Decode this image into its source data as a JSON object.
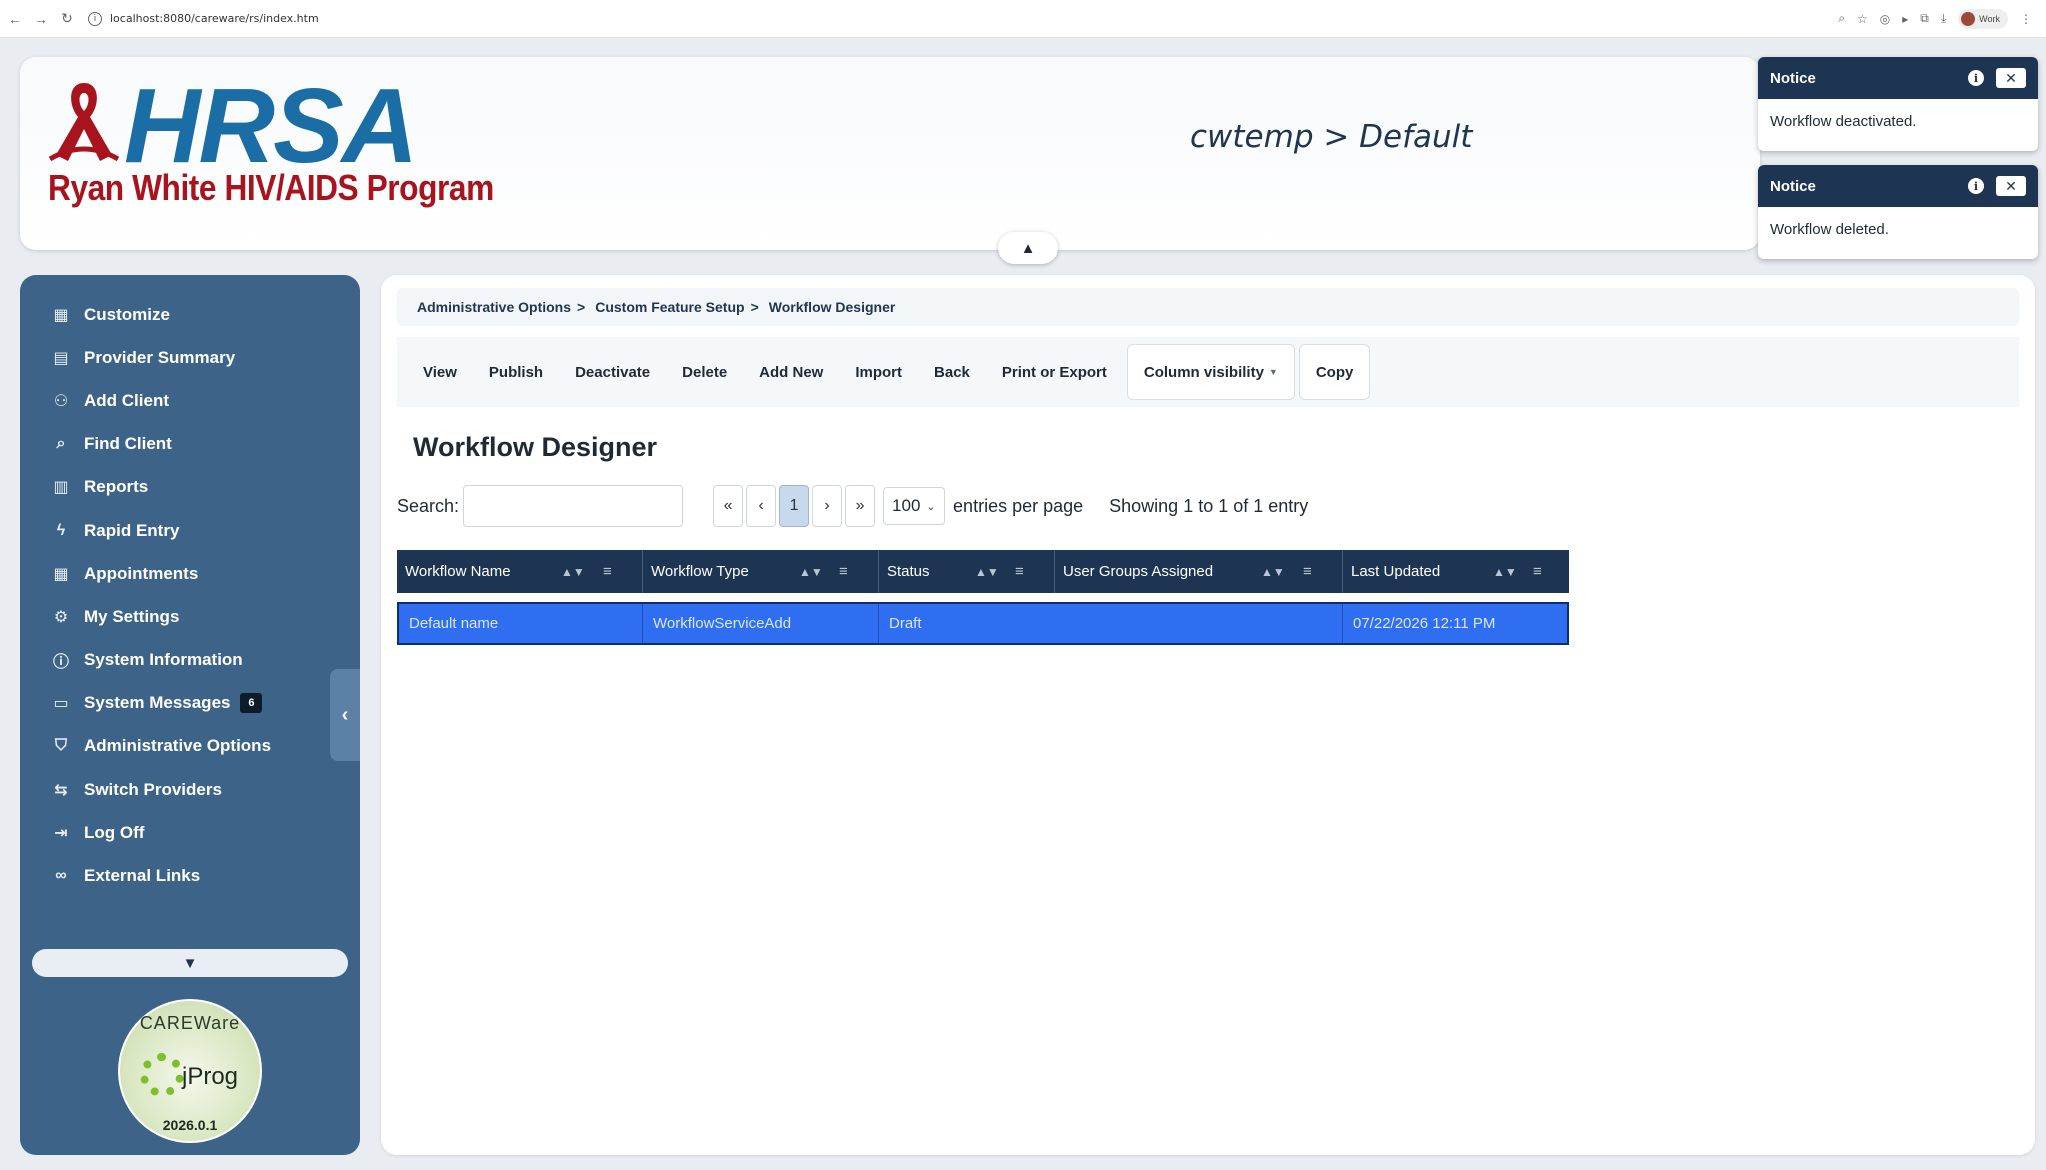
{
  "browser": {
    "url": "localhost:8080/careware/rs/index.htm",
    "profile_label": "Work"
  },
  "header": {
    "logo_main": "HRSA",
    "logo_sub": "Ryan White HIV/AIDS Program",
    "context": "cwtemp > Default"
  },
  "notices": [
    {
      "title": "Notice",
      "message": "Workflow deactivated."
    },
    {
      "title": "Notice",
      "message": "Workflow deleted."
    }
  ],
  "sidebar": {
    "items": [
      {
        "label": "Customize",
        "icon": "layout-icon"
      },
      {
        "label": "Provider Summary",
        "icon": "clipboard-icon"
      },
      {
        "label": "Add Client",
        "icon": "add-user-icon"
      },
      {
        "label": "Find Client",
        "icon": "search-icon"
      },
      {
        "label": "Reports",
        "icon": "bar-chart-icon"
      },
      {
        "label": "Rapid Entry",
        "icon": "bolt-icon"
      },
      {
        "label": "Appointments",
        "icon": "layout-icon"
      },
      {
        "label": "My Settings",
        "icon": "gear-icon"
      },
      {
        "label": "System Information",
        "icon": "info-icon"
      },
      {
        "label": "System Messages",
        "icon": "message-icon",
        "badge": "6"
      },
      {
        "label": "Administrative Options",
        "icon": "shield-icon"
      },
      {
        "label": "Switch Providers",
        "icon": "swap-icon"
      },
      {
        "label": "Log Off",
        "icon": "logout-icon"
      },
      {
        "label": "External Links",
        "icon": "link-icon"
      }
    ],
    "careware": {
      "top": "CAREWare",
      "mid": "jProg",
      "version": "2026.0.1"
    }
  },
  "breadcrumb": {
    "items": [
      "Administrative Options",
      "Custom Feature Setup",
      "Workflow Designer"
    ],
    "separator": ">"
  },
  "toolbar": {
    "view": "View",
    "publish": "Publish",
    "deactivate": "Deactivate",
    "delete": "Delete",
    "add_new": "Add New",
    "import": "Import",
    "back": "Back",
    "print_export": "Print or Export",
    "column_visibility": "Column visibility",
    "copy": "Copy"
  },
  "page": {
    "title": "Workflow Designer",
    "search_label": "Search:",
    "search_value": "",
    "pager": {
      "first": "«",
      "prev": "‹",
      "current": "1",
      "next": "›",
      "last": "»"
    },
    "entries_value": "100",
    "entries_label": "entries per page",
    "showing": "Showing 1 to 1 of 1 entry"
  },
  "table": {
    "columns": [
      "Workflow Name",
      "Workflow Type",
      "Status",
      "User Groups Assigned",
      "Last Updated"
    ],
    "rows": [
      [
        "Default name",
        "WorkflowServiceAdd",
        "Draft",
        "",
        "07/22/2026 12:11 PM"
      ]
    ]
  },
  "colors": {
    "sidebar_bg": "#3d6488",
    "header_navy": "#1d3552",
    "selected_row": "#2f6ef0",
    "brand_blue": "#1a6ea5",
    "brand_red": "#a8141d"
  }
}
